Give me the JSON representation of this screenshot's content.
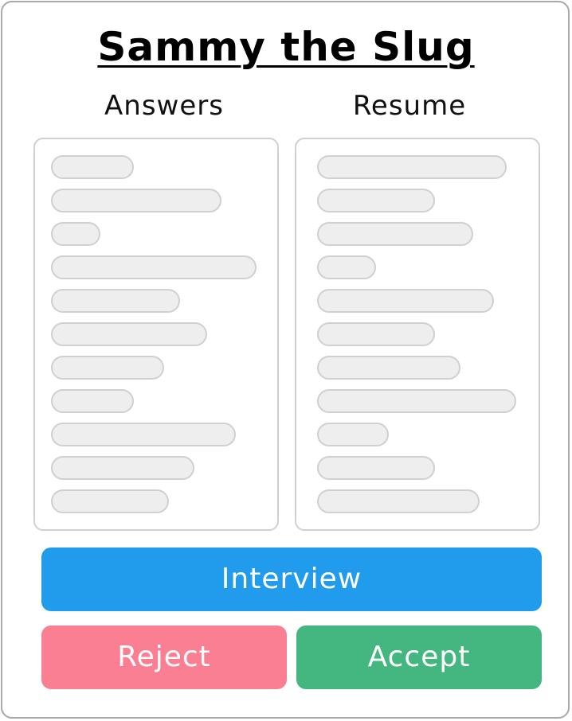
{
  "title": "Sammy the Slug",
  "columns": {
    "answers": {
      "heading": "Answers"
    },
    "resume": {
      "heading": "Resume"
    }
  },
  "actions": {
    "interview_label": "Interview",
    "reject_label": "Reject",
    "accept_label": "Accept"
  },
  "colors": {
    "interview": "#219bec",
    "reject": "#fb7f93",
    "accept": "#44b780"
  }
}
